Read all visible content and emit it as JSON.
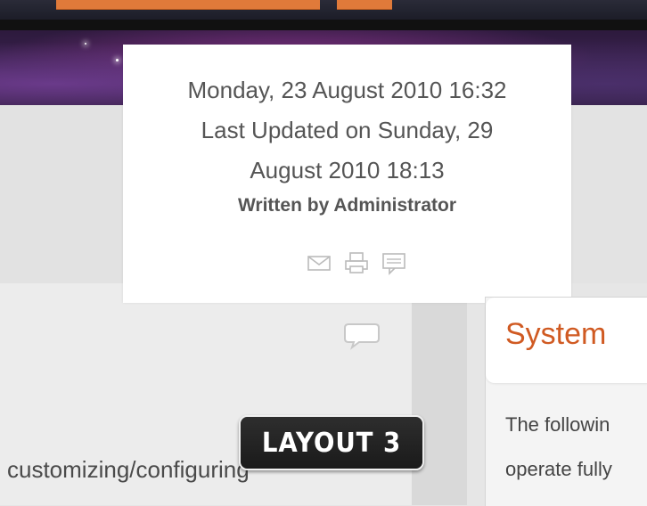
{
  "article": {
    "created": "Monday, 23 August 2010 16:32",
    "updated_line1": "Last Updated on Sunday, 29",
    "updated_line2": "August 2010 18:13",
    "author": "Written by Administrator"
  },
  "article_icons": [
    "email-icon",
    "print-icon",
    "comment-icon"
  ],
  "body": {
    "text_fragment": "customizing/configuring"
  },
  "badge": {
    "label": "LAYOUT 3"
  },
  "module": {
    "title": "System",
    "line1": "The followin",
    "line2": "operate fully"
  },
  "colors": {
    "accent": "#d05a22",
    "tab_orange": "#e07a3a",
    "text": "#555555"
  }
}
